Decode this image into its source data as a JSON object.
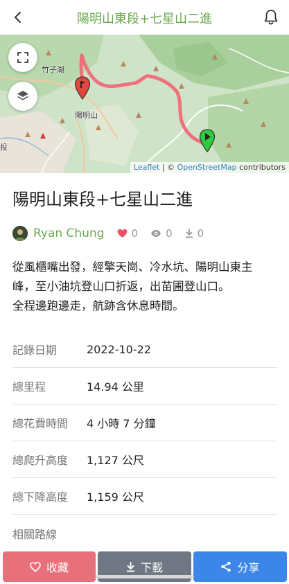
{
  "header": {
    "title": "陽明山東段+七星山二進"
  },
  "map": {
    "place_labels": [
      "竹子湖",
      "陽明山",
      "投"
    ],
    "attribution": {
      "leaflet": "Leaflet",
      "separator": " | © ",
      "osm": "OpenStreetMap",
      "suffix": " contributors"
    },
    "colors": {
      "route": "#f06a78",
      "end_marker": "#e0463c",
      "start_marker": "#2ecc40"
    }
  },
  "trail": {
    "title": "陽明山東段+七星山二進",
    "author": "Ryan Chung",
    "likes": "0",
    "views": "0",
    "downloads": "0",
    "description": [
      "從風櫃嘴出發，經擎天崗、冷水坑、陽明山東主",
      "峰，至小油坑登山口折返，出苗圃登山口。",
      "全程邊跑邊走，航跡含休息時間。"
    ]
  },
  "info": [
    {
      "label": "記錄日期",
      "value": "2022-10-22"
    },
    {
      "label": "總里程",
      "value": "14.94 公里"
    },
    {
      "label": "總花費時間",
      "value": "4 小時 7 分鐘"
    },
    {
      "label": "總爬升高度",
      "value": "1,127 公尺"
    },
    {
      "label": "總下降高度",
      "value": "1,159 公尺"
    },
    {
      "label": "相關路線",
      "value": ""
    }
  ],
  "actions": {
    "favorite": "收藏",
    "download": "下載",
    "share": "分享"
  },
  "theme": {
    "accent": "#6aa84f",
    "favorite_color": "#e8707a",
    "download_color": "#6e7782",
    "share_color": "#3b86e8",
    "like_heart_color": "#e8556a"
  }
}
